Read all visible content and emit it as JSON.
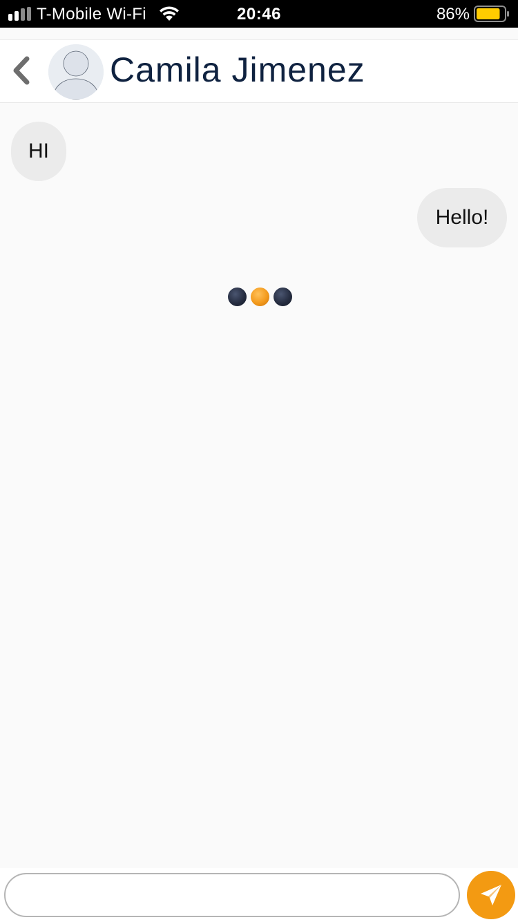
{
  "status_bar": {
    "carrier": "T-Mobile Wi-Fi",
    "time": "20:46",
    "battery_percent": "86%",
    "battery_level": 0.86,
    "signal_icon": "signal-bars-icon",
    "wifi_icon": "wifi-icon",
    "battery_icon": "battery-icon"
  },
  "header": {
    "back_icon": "chevron-left-icon",
    "avatar_icon": "default-avatar-icon",
    "contact_name": "Camila Jimenez"
  },
  "messages": [
    {
      "direction": "incoming",
      "text": "HI"
    },
    {
      "direction": "outgoing",
      "text": "Hello!"
    }
  ],
  "typing_indicator": {
    "dots": [
      "dark",
      "orange",
      "dark"
    ]
  },
  "composer": {
    "value": "",
    "placeholder": "",
    "send_icon": "paper-plane-icon"
  },
  "colors": {
    "accent": "#f39a12",
    "name_text": "#0f2240",
    "bubble": "#ebebeb",
    "background": "#fafafa",
    "battery_fill": "#ffcc00"
  }
}
